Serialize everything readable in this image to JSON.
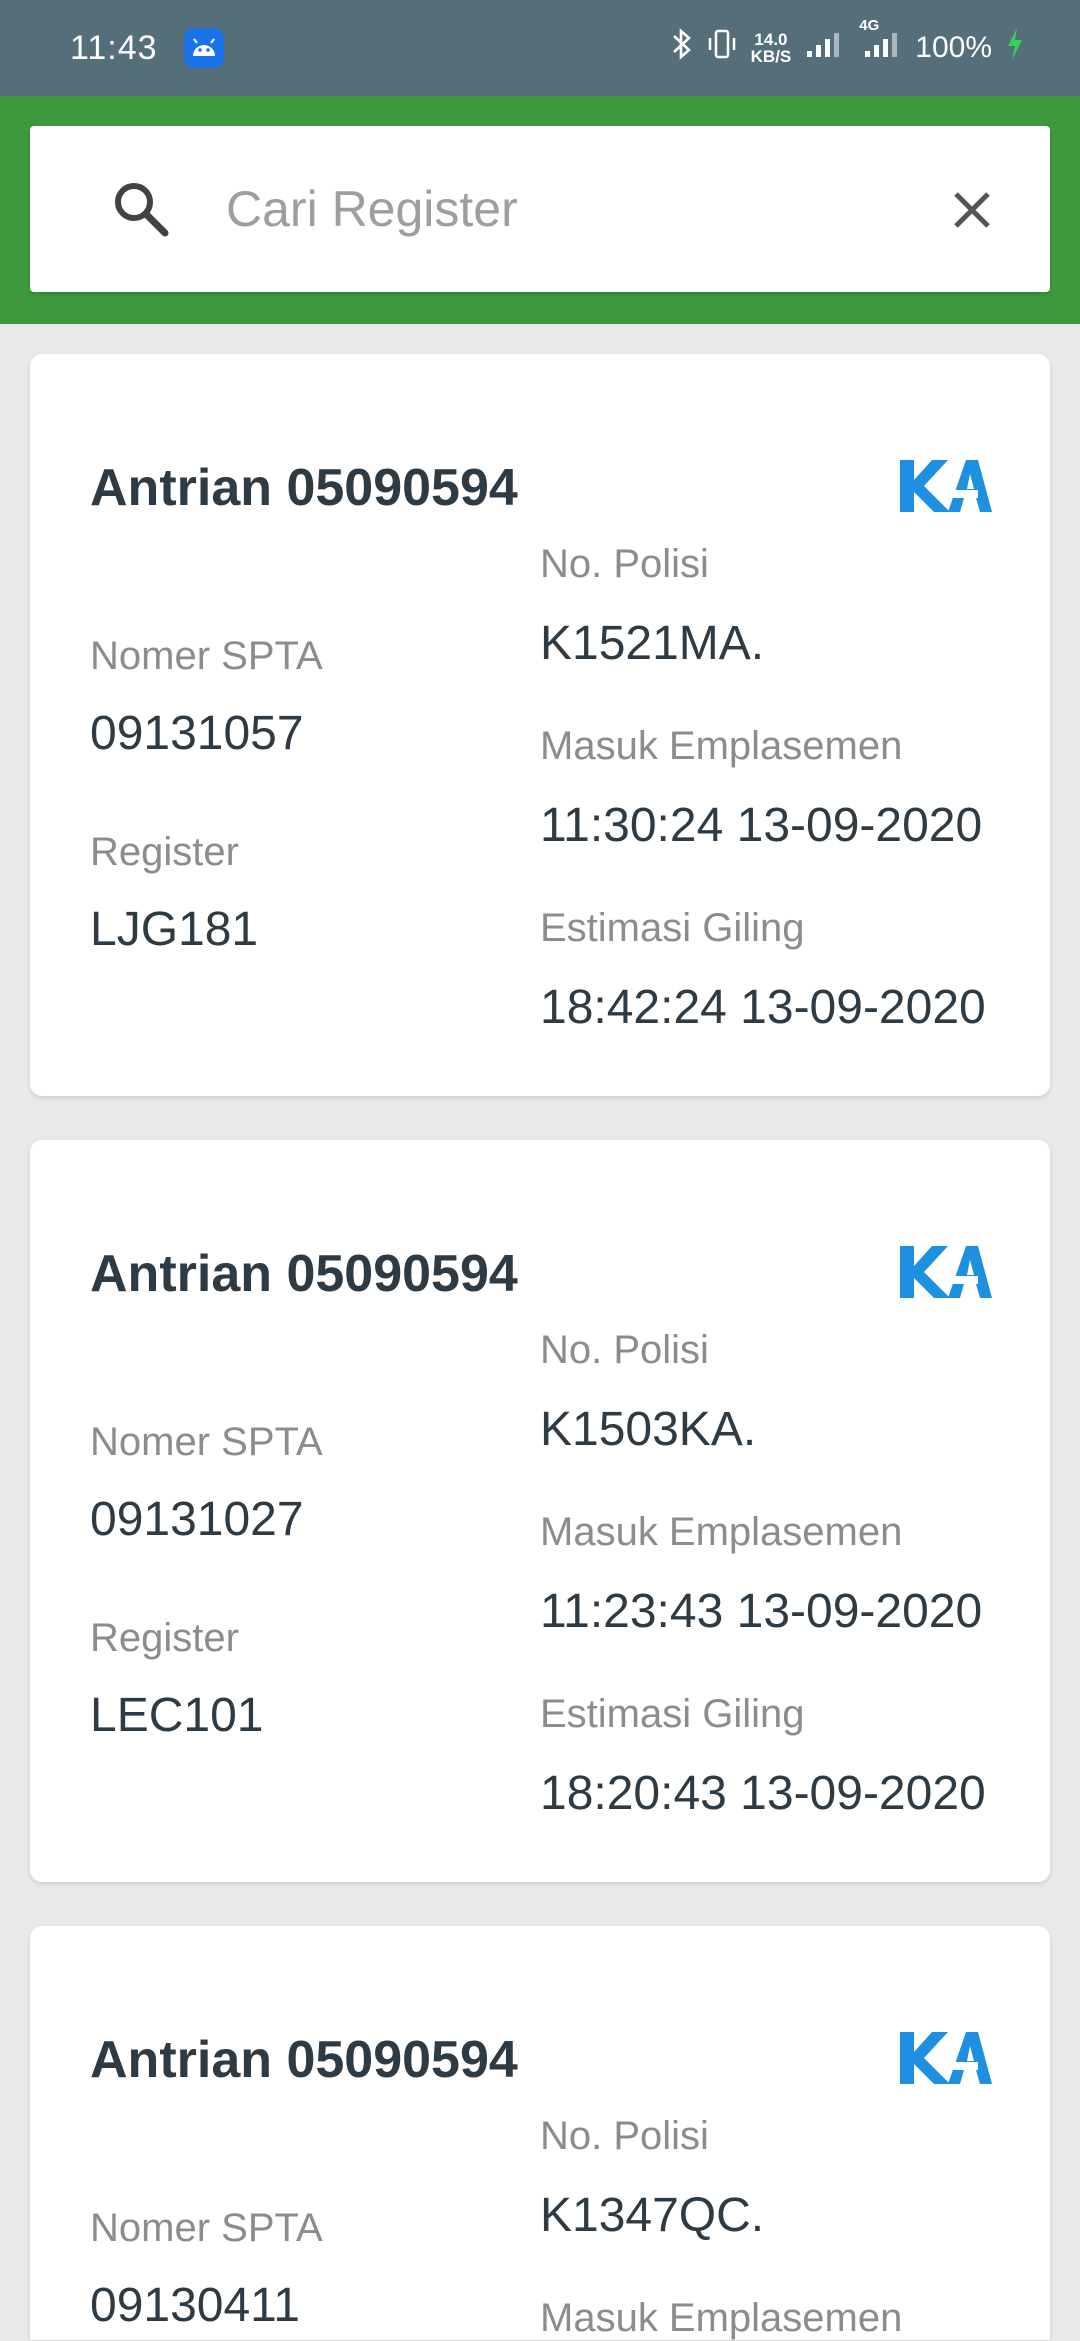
{
  "status_bar": {
    "time": "11:43",
    "net_speed_top": "14.0",
    "net_speed_bottom": "KB/S",
    "network": "4G",
    "battery": "100%"
  },
  "search": {
    "placeholder": "Cari Register",
    "value": ""
  },
  "colors": {
    "status_bar": "#546e7a",
    "app_bar": "#3c9a3c",
    "logo_blue": "#1e90e0",
    "title_text": "#2f3b44",
    "label_text": "#8c8c8c"
  },
  "labels": {
    "nomer_spta": "Nomer SPTA",
    "register": "Register",
    "no_polisi": "No. Polisi",
    "masuk_emplasemen": "Masuk Emplasemen",
    "estimasi_giling": "Estimasi Giling"
  },
  "cards": [
    {
      "title": "Antrian 05090594",
      "nomer_spta": "09131057",
      "register": "LJG181",
      "no_polisi": "K1521MA.",
      "masuk_emplasemen": "11:30:24 13-09-2020",
      "estimasi_giling": "18:42:24 13-09-2020"
    },
    {
      "title": "Antrian 05090594",
      "nomer_spta": "09131027",
      "register": "LEC101",
      "no_polisi": "K1503KA.",
      "masuk_emplasemen": "11:23:43 13-09-2020",
      "estimasi_giling": "18:20:43 13-09-2020"
    },
    {
      "title": "Antrian 05090594",
      "nomer_spta": "09130411",
      "no_polisi": "K1347QC."
    }
  ]
}
